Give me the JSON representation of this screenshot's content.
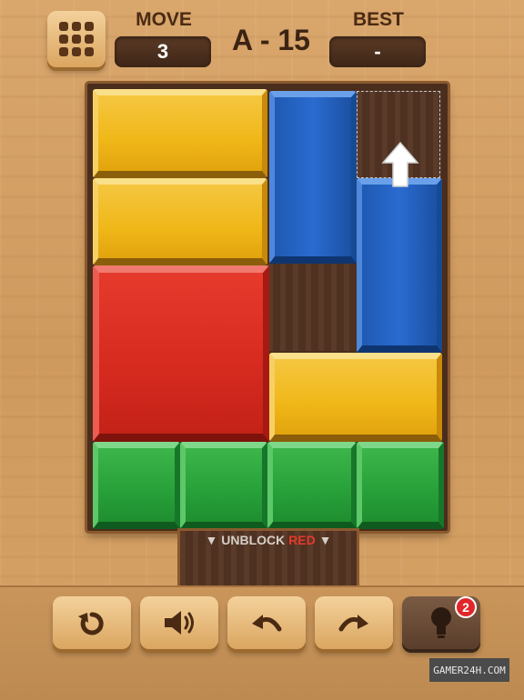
{
  "header": {
    "menu_icon": "grid-icon",
    "move_label": "MOVE",
    "move_value": "3",
    "level": "A - 15",
    "best_label": "BEST",
    "best_value": "-"
  },
  "board": {
    "exit_hint_prefix": "UNBLOCK",
    "exit_hint_color_word": "RED",
    "exit_indicator_icon": "triangle-down-icon",
    "move_hint_icon": "arrow-up-icon"
  },
  "toolbar": {
    "buttons": [
      {
        "icon": "restart-icon"
      },
      {
        "icon": "sound-icon"
      },
      {
        "icon": "undo-icon"
      },
      {
        "icon": "redo-icon"
      },
      {
        "icon": "hint-bulb-icon"
      }
    ],
    "hint_count": "2"
  },
  "watermark": "GAMER24H.COM",
  "colors": {
    "yellow": "#f0b718",
    "blue": "#2a6bd0",
    "red": "#d62a1f",
    "green": "#27a039"
  }
}
